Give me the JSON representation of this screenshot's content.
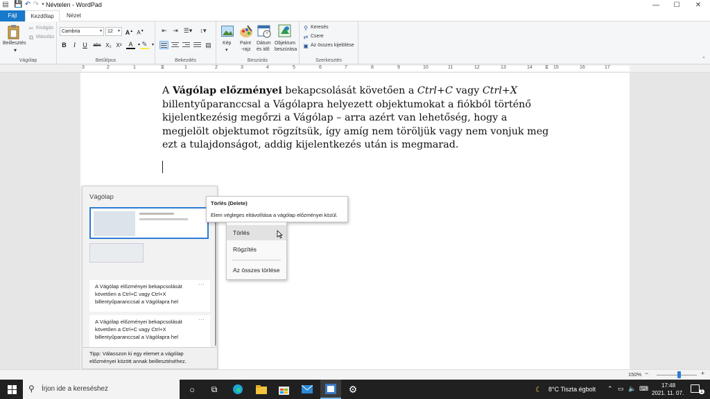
{
  "window": {
    "title": "Névtelen - WordPad",
    "controls": {
      "minimize": "—",
      "maximize": "☐",
      "close": "✕"
    }
  },
  "quick_access": {
    "save": "💾",
    "undo": "↶",
    "redo": "↷",
    "more": "▾"
  },
  "tabs": [
    {
      "label": "Fájl"
    },
    {
      "label": "Kezdőlap"
    },
    {
      "label": "Nézet"
    }
  ],
  "ribbon": {
    "clipboard": {
      "paste_label": "Beillesztés",
      "cut_label": "Kivágás",
      "copy_label": "Másolás",
      "group_label": "Vágólap"
    },
    "font": {
      "family": "Cambria",
      "size": "12",
      "grow": "A",
      "shrink": "A",
      "bold": "B",
      "italic": "I",
      "underline": "U",
      "strikethrough": "abc",
      "subscript": "X₂",
      "superscript": "X²",
      "font_color": "A",
      "group_label": "Betűtípus"
    },
    "paragraph": {
      "group_label": "Bekezdés"
    },
    "insert": {
      "picture_label": "Kép",
      "paint_label_1": "Paint",
      "paint_label_2": "-rajz",
      "datetime_label_1": "Dátum",
      "datetime_label_2": "és idő",
      "object_label_1": "Objektum",
      "object_label_2": "beszúrása",
      "group_label": "Beszúrás"
    },
    "editing": {
      "find_label": "Keresés",
      "replace_label": "Csere",
      "select_all_label": "Az összes kijelölése",
      "group_label": "Szerkesztés"
    }
  },
  "ruler": {
    "numbers": [
      "3",
      "2",
      "1",
      "1",
      "2",
      "3",
      "4",
      "5",
      "6",
      "7",
      "8",
      "9",
      "10",
      "11",
      "12",
      "13",
      "14",
      "15",
      "16",
      "17"
    ]
  },
  "document": {
    "p_start": "A ",
    "p_bold": "Vágólap előzményei",
    "p_mid1": " bekapcsolását követően a ",
    "p_ital1": "Ctrl+C",
    "p_mid2": " vagy ",
    "p_ital2": "Ctrl+X",
    "p_rest": " billentyűparanccsal a Vágólapra helyezett objektumokat a fiókból történő kijelentkezésig megőrzi a Vágólap – arra azért van lehetőség, hogy a megjelölt objektumot rögzítsük, így amíg nem töröljük vagy nem vonjuk meg ezt a tulajdonságot, addig kijelentkezés után is megmarad."
  },
  "clipboard_panel": {
    "title": "Vágólap",
    "text_items": [
      {
        "text": "A Vágólap előzményei bekapcsolását követően a Ctrl+C vagy Ctrl+X billentyűparanccsal a Vágólapra hel",
        "more": "···"
      },
      {
        "text": "A Vágólap előzményei bekapcsolását követően a Ctrl+C vagy Ctrl+X billentyűparanccsal a Vágólapra hel",
        "more": "···"
      }
    ],
    "tip": "Tipp: Válasszon ki egy elemet a vágólap előzményei között annak beillesztéséhez."
  },
  "tooltip": {
    "title": "Törlés (Delete)",
    "description": "Elem végleges eltávolítása a vágólap előzményei közül."
  },
  "context_menu": {
    "items": [
      {
        "label": "Törlés"
      },
      {
        "label": "Rögzítés"
      },
      {
        "label": "Az összes törlése"
      }
    ]
  },
  "status_bar": {
    "zoom": "150%",
    "zoom_out": "−",
    "zoom_in": "+",
    "zoom_level": 0.55
  },
  "taskbar": {
    "search_placeholder": "Írjon ide a kereséshez",
    "weather": "8°C  Tiszta égbolt",
    "time": "17:48",
    "date": "2021. 11. 07.",
    "notifications": "1"
  },
  "colors": {
    "accent": "#1979ca",
    "selection_border": "#2b7cd3",
    "taskbar": "#202020"
  }
}
